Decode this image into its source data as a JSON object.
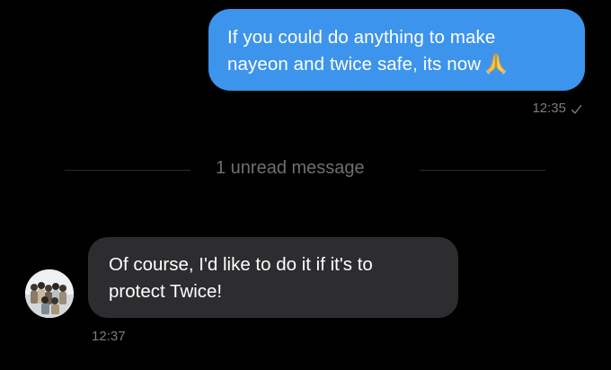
{
  "colors": {
    "background": "#000000",
    "outgoing_bubble": "#3d94ec",
    "incoming_bubble": "#2d2d30",
    "meta_text": "#7d7d82",
    "divider_text": "#6e6e73"
  },
  "messages": {
    "outgoing": {
      "line1": "If you could do anything to make",
      "line2": "nayeon and twice safe, its now",
      "emoji": "folded-hands-icon",
      "time": "12:35",
      "status_icon": "check-icon"
    },
    "divider": {
      "label": "1 unread message"
    },
    "incoming": {
      "line1": "Of course, I'd like to do it if it's to",
      "line2": "protect Twice!",
      "time": "12:37",
      "avatar": "group-photo-avatar"
    }
  }
}
